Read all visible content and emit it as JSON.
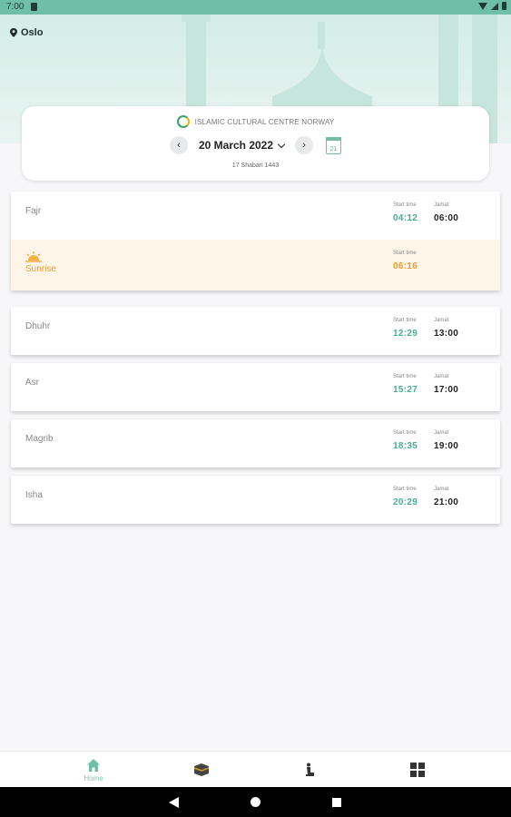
{
  "status_bar": {
    "time": "7:00"
  },
  "location": "Oslo",
  "org_name": "ISLAMIC CULTURAL CENTRE NORWAY",
  "date": "20 March 2022",
  "calendar_day": "21",
  "hijri_date": "17 Shaban 1443",
  "prayers": [
    {
      "name": "Fajr",
      "start_label": "Start time",
      "start": "04:12",
      "jamat_label": "Jamat",
      "jamat": "06:00"
    },
    {
      "name": "Sunrise",
      "start_label": "Start time",
      "start": "06:16"
    },
    {
      "name": "Dhuhr",
      "start_label": "Start time",
      "start": "12:29",
      "jamat_label": "Jamat",
      "jamat": "13:00"
    },
    {
      "name": "Asr",
      "start_label": "Start time",
      "start": "15:27",
      "jamat_label": "Jamat",
      "jamat": "17:00"
    },
    {
      "name": "Magrib",
      "start_label": "Start time",
      "start": "18:35",
      "jamat_label": "Jamat",
      "jamat": "19:00"
    },
    {
      "name": "Isha",
      "start_label": "Start time",
      "start": "20:29",
      "jamat_label": "Jamat",
      "jamat": "21:00"
    }
  ],
  "nav": {
    "home_label": "Home"
  },
  "colors": {
    "accent": "#4aab93",
    "sunrise": "#f39a2b",
    "status_bar": "#6fbfa6"
  }
}
